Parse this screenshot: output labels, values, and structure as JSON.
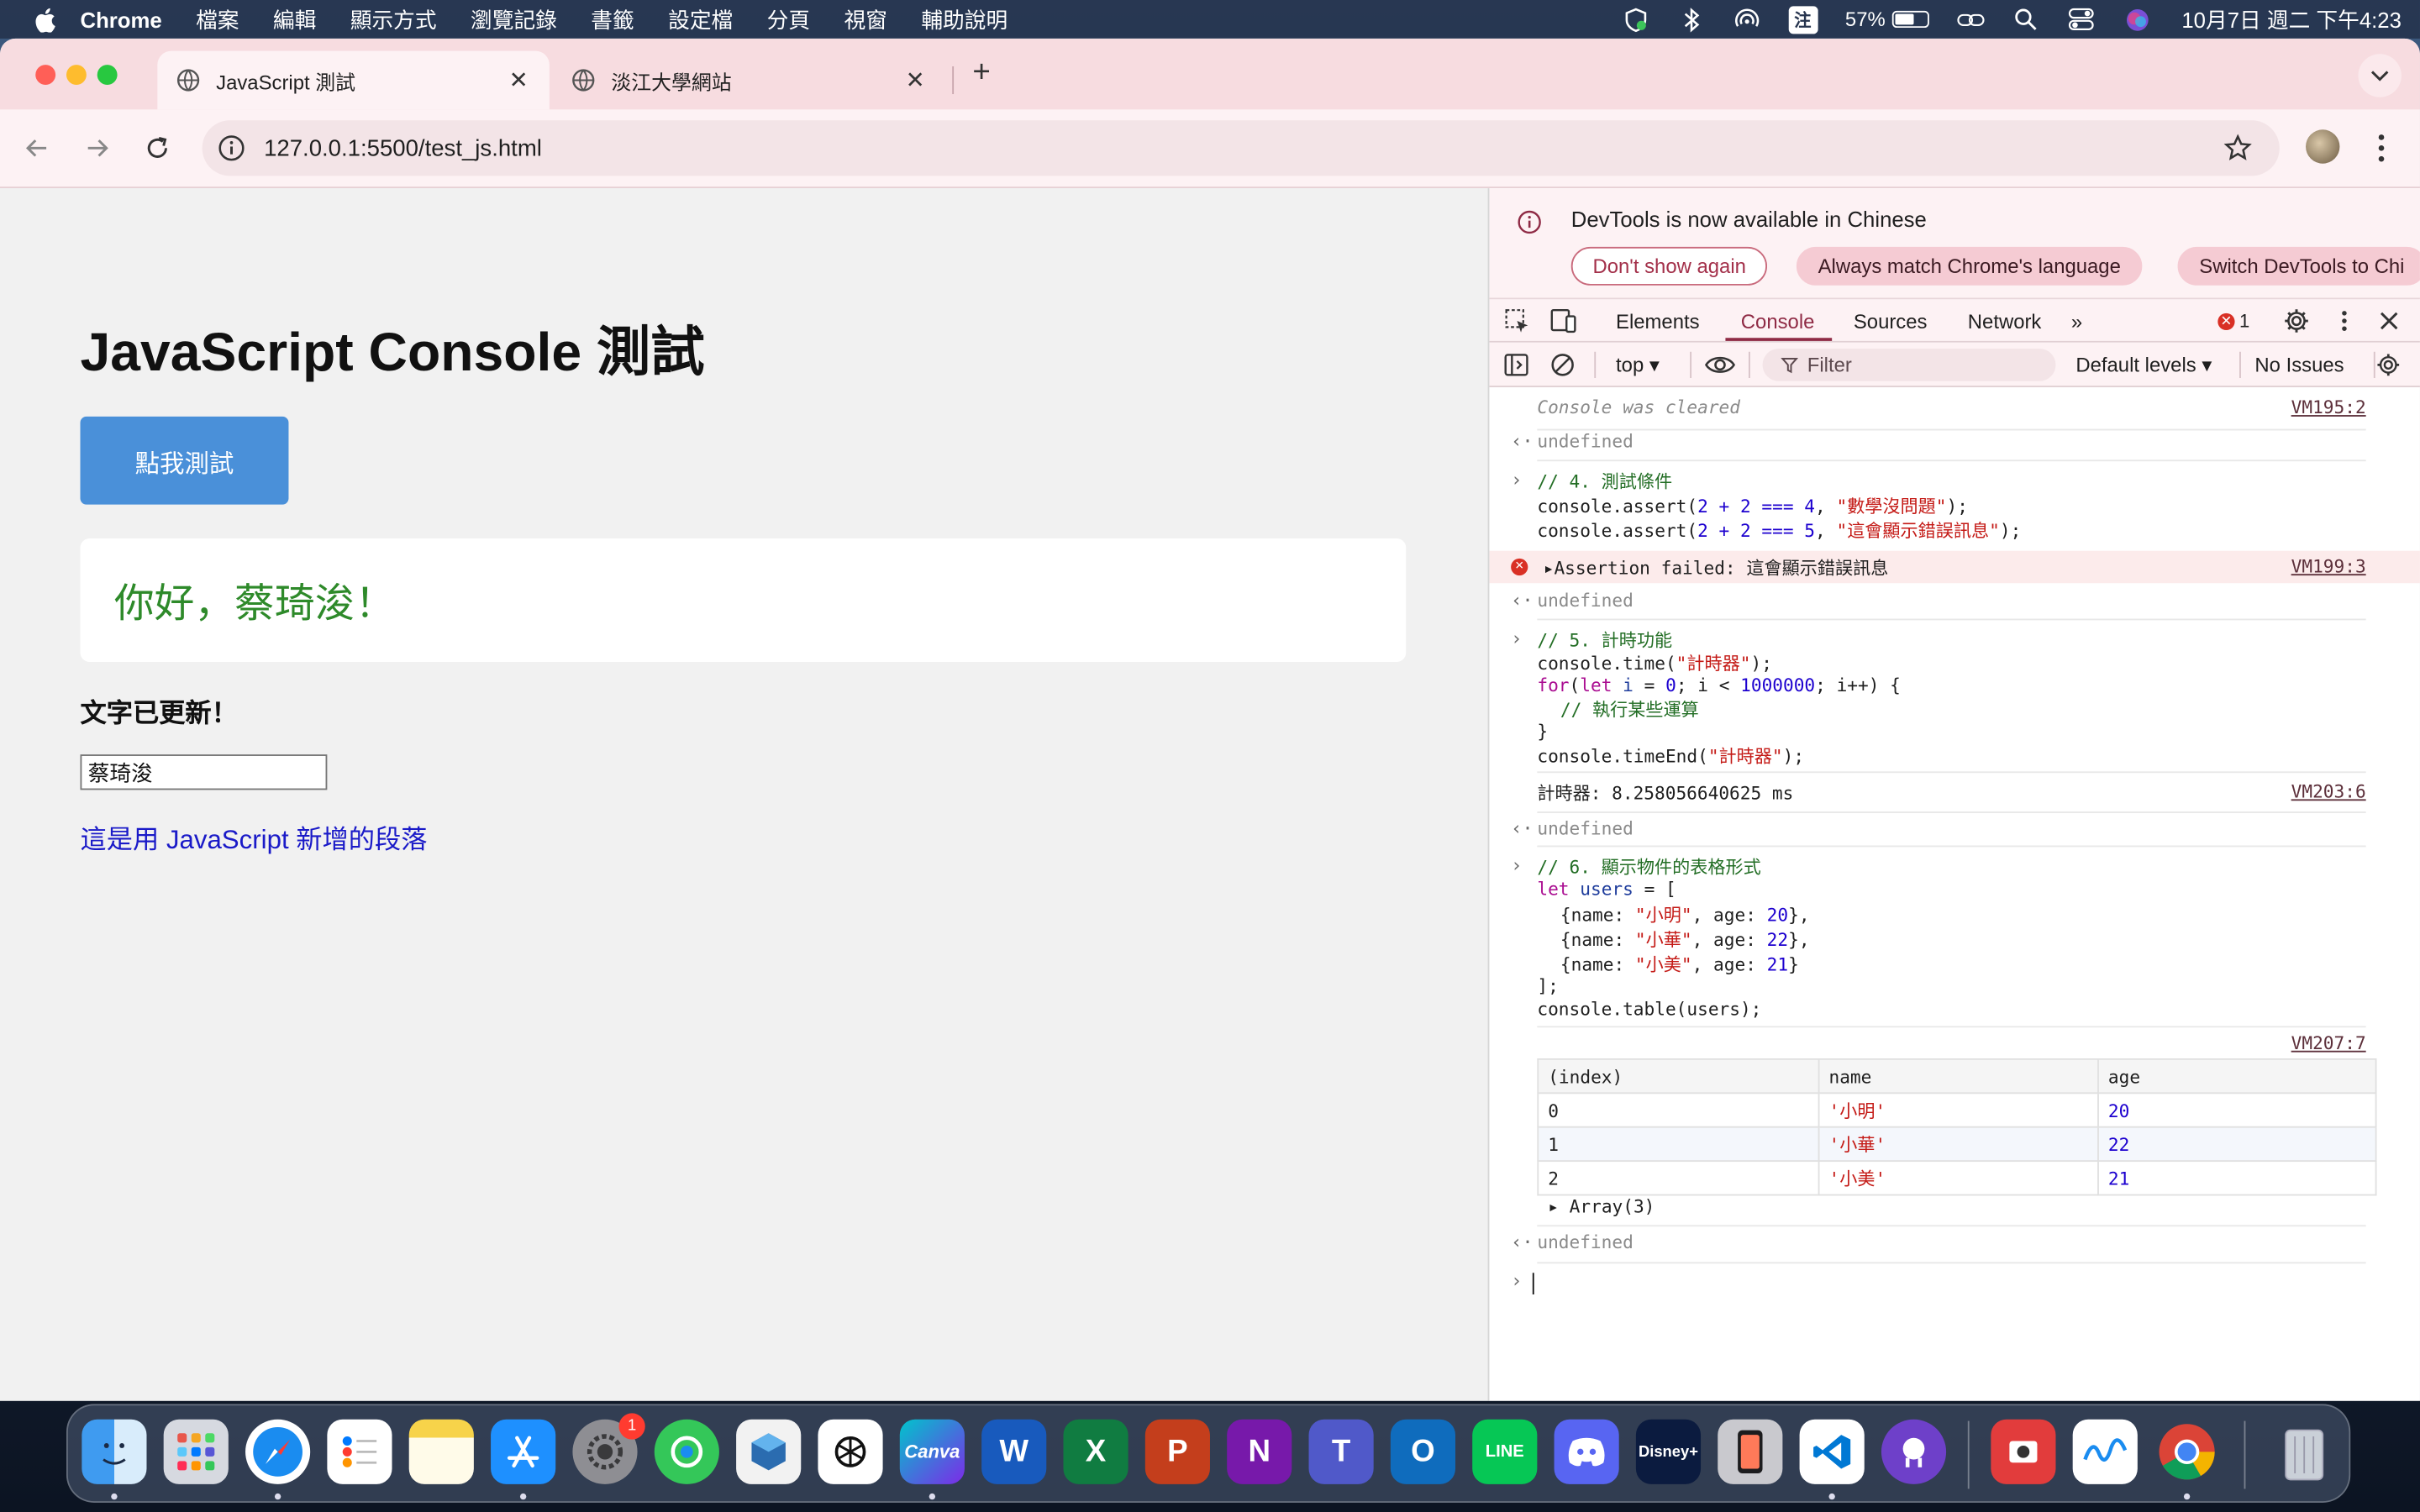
{
  "menubar": {
    "app_name": "Chrome",
    "items": [
      "檔案",
      "編輯",
      "顯示方式",
      "瀏覽記錄",
      "書籤",
      "設定檔",
      "分頁",
      "視窗",
      "輔助說明"
    ],
    "ime_label": "注",
    "battery_percent": "57%",
    "clock": "10月7日 週二 下午4:23"
  },
  "browser": {
    "tabs": [
      {
        "title": "JavaScript 測試",
        "active": true
      },
      {
        "title": "淡江大學網站",
        "active": false
      }
    ],
    "url": "127.0.0.1:5500/test_js.html"
  },
  "page": {
    "heading": "JavaScript Console 測試",
    "button_label": "點我測試",
    "greeting": "你好，蔡琦浚！",
    "updated_text": "文字已更新！",
    "input_value": "蔡琦浚",
    "added_paragraph": "這是用 JavaScript 新增的段落"
  },
  "devtools": {
    "banner": {
      "message": "DevTools is now available in Chinese",
      "btn_dont_show": "Don't show again",
      "btn_match_language": "Always match Chrome's language",
      "btn_switch": "Switch DevTools to Chi"
    },
    "tabs": [
      "Elements",
      "Console",
      "Sources",
      "Network"
    ],
    "active_tab": "Console",
    "error_count": "1",
    "context": "top ▾",
    "filter_placeholder": "Filter",
    "levels": "Default levels ▾",
    "issues": "No Issues",
    "console": {
      "cleared": "Console was cleared",
      "cleared_src": "VM195:2",
      "undefined": "undefined",
      "block4_l1": "// 4. 測試條件",
      "block4_l2a": "console.assert(",
      "block4_l2_expr": "2 + 2 === 4",
      "block4_l2_str": "\"數學沒問題\"",
      "block4_l3_expr": "2 + 2 === 5",
      "block4_l3_str": "\"這會顯示錯誤訊息\"",
      "assert_msg": "Assertion failed: 這會顯示錯誤訊息",
      "assert_src": "VM199:3",
      "block5_l1": "// 5. 計時功能",
      "block5_l2_str": "\"計時器\"",
      "block5_loop_var": "i",
      "block5_loop_start": "0",
      "block5_loop_end": "1000000",
      "block5_l4": "// 執行某些運算",
      "timer_output": "計時器: 8.258056640625 ms",
      "timer_src": "VM203:6",
      "block6_l1": "// 6. 顯示物件的表格形式",
      "block6_var": "users",
      "users": [
        {
          "name": "\"小明\"",
          "age": "20"
        },
        {
          "name": "\"小華\"",
          "age": "22"
        },
        {
          "name": "\"小美\"",
          "age": "21"
        }
      ],
      "table_src": "VM207:7",
      "table_headers": [
        "(index)",
        "name",
        "age"
      ],
      "table_rows": [
        {
          "index": "0",
          "name": "'小明'",
          "age": "20"
        },
        {
          "index": "1",
          "name": "'小華'",
          "age": "22"
        },
        {
          "index": "2",
          "name": "'小美'",
          "age": "21"
        }
      ],
      "array_summary": "Array(3)"
    }
  },
  "dock": {
    "settings_badge": "1",
    "apps": [
      "finder-icon",
      "launchpad-icon",
      "safari-icon",
      "reminders-icon",
      "notes-icon",
      "app-store-icon",
      "system-settings-icon",
      "find-my-icon",
      "virtualbox-icon",
      "chatgpt-icon",
      "canva-icon",
      "word-icon",
      "excel-icon",
      "powerpoint-icon",
      "onenote-icon",
      "teams-icon",
      "outlook-icon",
      "line-icon",
      "discord-icon",
      "disney-plus-icon",
      "iphone-mirroring-icon",
      "vscode-icon",
      "github-desktop-icon",
      "photo-booth-icon",
      "freeform-icon",
      "chrome-icon",
      "trash-icon"
    ],
    "canva_label": "Canva",
    "line_label": "LINE",
    "disney_label": "Disney+"
  }
}
